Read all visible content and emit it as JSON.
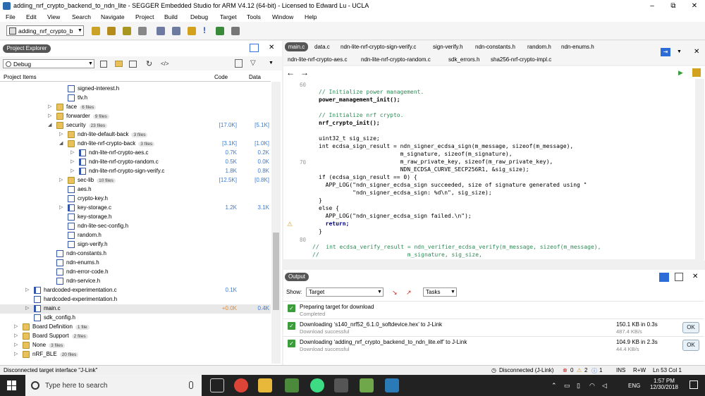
{
  "window": {
    "title": "adding_nrf_crypto_backend_to_ndn_lite - SEGGER Embedded Studio for ARM V4.12 (64-bit) - Licensed to Edward Lu - UCLA",
    "minimize": "–",
    "maximize": "⧉",
    "close": "✕"
  },
  "menu": [
    "File",
    "Edit",
    "View",
    "Search",
    "Navigate",
    "Project",
    "Build",
    "Debug",
    "Target",
    "Tools",
    "Window",
    "Help"
  ],
  "toolbar": {
    "project_combo": "adding_nrf_crypto_b"
  },
  "project_explorer": {
    "tab": "Project Explorer",
    "config": "Debug",
    "col_items": "Project Items",
    "col_code": "Code",
    "col_data": "Data",
    "rows": [
      {
        "label": "signed-interest.h",
        "count": "",
        "code": "",
        "data": "",
        "indent": 100,
        "kind": "file",
        "exp": ""
      },
      {
        "label": "tlv.h",
        "count": "",
        "code": "",
        "data": "",
        "indent": 100,
        "kind": "file",
        "exp": ""
      },
      {
        "label": "face",
        "count": "6 files",
        "code": "",
        "data": "",
        "indent": 84,
        "kind": "folder",
        "exp": "▷"
      },
      {
        "label": "forwarder",
        "count": "9 files",
        "code": "",
        "data": "",
        "indent": 84,
        "kind": "folder",
        "exp": "▷"
      },
      {
        "label": "security",
        "count": "23 files",
        "code": "[17.0K]",
        "data": "[5.1K]",
        "indent": 84,
        "kind": "folder",
        "exp": "◢"
      },
      {
        "label": "ndn-lite-default-back",
        "count": "3 files",
        "code": "",
        "data": "",
        "indent": 100,
        "kind": "folder",
        "exp": "▷"
      },
      {
        "label": "ndn-lite-nrf-crypto-back",
        "count": "3 files",
        "code": "[3.1K]",
        "data": "[1.0K]",
        "indent": 100,
        "kind": "folder",
        "exp": "◢"
      },
      {
        "label": "ndn-lite-nrf-crypto-aes.c",
        "count": "",
        "code": "0.7K",
        "data": "0.2K",
        "indent": 116,
        "kind": "cfile",
        "exp": "▷"
      },
      {
        "label": "ndn-lite-nrf-crypto-random.c",
        "count": "",
        "code": "0.5K",
        "data": "0.0K",
        "indent": 116,
        "kind": "cfile",
        "exp": "▷"
      },
      {
        "label": "ndn-lite-nrf-crypto-sign-verify.c",
        "count": "",
        "code": "1.8K",
        "data": "0.8K",
        "indent": 116,
        "kind": "cfile",
        "exp": "▷"
      },
      {
        "label": "sec-lib",
        "count": "10 files",
        "code": "[12.5K]",
        "data": "[0.8K]",
        "indent": 100,
        "kind": "folder",
        "exp": "▷"
      },
      {
        "label": "aes.h",
        "count": "",
        "code": "",
        "data": "",
        "indent": 100,
        "kind": "file",
        "exp": ""
      },
      {
        "label": "crypto-key.h",
        "count": "",
        "code": "",
        "data": "",
        "indent": 100,
        "kind": "file",
        "exp": ""
      },
      {
        "label": "key-storage.c",
        "count": "",
        "code": "1.2K",
        "data": "3.1K",
        "indent": 100,
        "kind": "cfile",
        "exp": "▷"
      },
      {
        "label": "key-storage.h",
        "count": "",
        "code": "",
        "data": "",
        "indent": 100,
        "kind": "file",
        "exp": ""
      },
      {
        "label": "ndn-lite-sec-config.h",
        "count": "",
        "code": "",
        "data": "",
        "indent": 100,
        "kind": "file",
        "exp": ""
      },
      {
        "label": "random.h",
        "count": "",
        "code": "",
        "data": "",
        "indent": 100,
        "kind": "file",
        "exp": ""
      },
      {
        "label": "sign-verify.h",
        "count": "",
        "code": "",
        "data": "",
        "indent": 100,
        "kind": "file",
        "exp": ""
      },
      {
        "label": "ndn-constants.h",
        "count": "",
        "code": "",
        "data": "",
        "indent": 84,
        "kind": "file",
        "exp": ""
      },
      {
        "label": "ndn-enums.h",
        "count": "",
        "code": "",
        "data": "",
        "indent": 84,
        "kind": "file",
        "exp": ""
      },
      {
        "label": "ndn-error-code.h",
        "count": "",
        "code": "",
        "data": "",
        "indent": 84,
        "kind": "file",
        "exp": ""
      },
      {
        "label": "ndn-service.h",
        "count": "",
        "code": "",
        "data": "",
        "indent": 84,
        "kind": "file",
        "exp": ""
      },
      {
        "label": "hardcoded-experimentation.c",
        "count": "",
        "code": "0.1K",
        "data": "",
        "indent": 52,
        "kind": "cfile",
        "exp": "▷"
      },
      {
        "label": "hardcoded-experimentation.h",
        "count": "",
        "code": "",
        "data": "",
        "indent": 52,
        "kind": "file",
        "exp": ""
      },
      {
        "label": "main.c",
        "count": "",
        "code": "+0.0K",
        "data": "0.4K",
        "indent": 52,
        "kind": "cfile",
        "exp": "▷",
        "selected": true
      },
      {
        "label": "sdk_config.h",
        "count": "",
        "code": "",
        "data": "",
        "indent": 52,
        "kind": "file",
        "exp": ""
      },
      {
        "label": "Board Definition",
        "count": "1 file",
        "code": "",
        "data": "",
        "indent": 36,
        "kind": "folder",
        "exp": "▷"
      },
      {
        "label": "Board Support",
        "count": "2 files",
        "code": "",
        "data": "",
        "indent": 36,
        "kind": "folder",
        "exp": "▷"
      },
      {
        "label": "None",
        "count": "3 files",
        "code": "",
        "data": "",
        "indent": 36,
        "kind": "folder",
        "exp": "▷"
      },
      {
        "label": "nRF_BLE",
        "count": "20 files",
        "code": "",
        "data": "",
        "indent": 36,
        "kind": "folder",
        "exp": "▷"
      }
    ]
  },
  "editor": {
    "tabs_row1": [
      "main.c",
      "data.c",
      "ndn-lite-nrf-crypto-sign-verify.c",
      "sign-verify.h",
      "ndn-constants.h",
      "random.h",
      "ndn-enums.h"
    ],
    "tabs_row2": [
      "ndn-lite-nrf-crypto-aes.c",
      "ndn-lite-nrf-crypto-random.c",
      "sdk_errors.h",
      "sha256-nrf-crypto-impl.c"
    ],
    "line_numbers": [
      "60",
      "70",
      "80"
    ],
    "code": [
      "// Initialize power management.",
      "power_management_init();",
      "",
      "// Initialize nrf crypto.",
      "nrf_crypto_init();",
      "",
      "uint32_t sig_size;",
      "int ecdsa_sign_result = ndn_signer_ecdsa_sign(m_message, sizeof(m_message),",
      "                        m_signature, sizeof(m_signature),",
      "                        m_raw_private_key, sizeof(m_raw_private_key),",
      "                        NDN_ECDSA_CURVE_SECP256R1, &sig_size);",
      "if (ecdsa_sign_result == 0) {",
      "  APP_LOG(\"ndn_signer_ecdsa_sign succeeded, size of signature generated using \"",
      "          \"ndn_signer_ecdsa_sign: %d\\n\", sig_size);",
      "}",
      "else {",
      "  APP_LOG(\"ndn_signer_ecdsa_sign failed.\\n\");",
      "  return;",
      "}",
      "",
      "//  int ecdsa_verify_result = ndn_verifier_ecdsa_verify(m_message, sizeof(m_message),",
      "//                          m_signature, sig_size,"
    ]
  },
  "output": {
    "tab": "Output",
    "show_label": "Show:",
    "target": "Target",
    "tasks": "Tasks",
    "items": [
      {
        "title": "Preparing target for download",
        "sub": "Completed",
        "r1": "",
        "r2": "",
        "ok": ""
      },
      {
        "title": "Downloading ‘s140_nrf52_6.1.0_softdevice.hex’ to J-Link",
        "sub": "Download successful",
        "r1": "150.1 KB in 0.3s",
        "r2": "487.4 KB/s",
        "ok": "OK"
      },
      {
        "title": "Downloading ‘adding_nrf_crypto_backend_to_ndn_lite.elf’ to J-Link",
        "sub": "Download successful",
        "r1": "104.9 KB in 2.3s",
        "r2": "44.4 KB/s",
        "ok": "OK"
      }
    ]
  },
  "status": {
    "left": "Disconnected target interface \"J-Link\"",
    "conn": "Disconnected (J-Link)",
    "errors": "0",
    "warnings": "2",
    "info": "1",
    "ins": "INS",
    "rw": "R+W",
    "pos": "Ln 53 Col 1"
  },
  "taskbar": {
    "search": "Type here to search",
    "lang": "ENG",
    "time": "1:57 PM",
    "date": "12/30/2018"
  }
}
